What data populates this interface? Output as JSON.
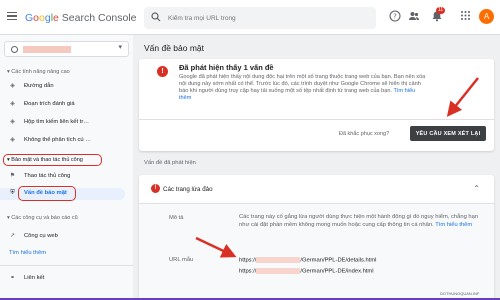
{
  "app": {
    "title_parts": [
      "G",
      "o",
      "o",
      "g",
      "l",
      "e",
      " Search Console"
    ]
  },
  "search": {
    "placeholder": "Kiểm tra mọi URL trong"
  },
  "topbar": {
    "notif_count": "11",
    "avatar_letter": "A"
  },
  "sidebar": {
    "section_enh": "Các tính năng nâng cao",
    "enh_items": [
      "Đường dẫn",
      "Đoạn trích đánh giá",
      "Hộp tìm kiếm liên kết tr…",
      "Không thể phân tích cú …"
    ],
    "section_sec": "Bảo mật và thao tác thủ công",
    "sec_items": [
      "Thao tác thủ công",
      "Vấn đề bảo mật"
    ],
    "section_legacy": "Các công cụ và báo cáo cũ",
    "legacy_items": [
      "Công cụ web"
    ],
    "learn_more": "Tìm hiểu thêm",
    "links_item": "Liên kết"
  },
  "main": {
    "page_title": "Vấn đề bảo mật",
    "alert": {
      "title": "Đã phát hiện thấy 1 vấn đề",
      "body": "Google đã phát hiện thấy nội dung độc hại trên một số trang thuộc trang web của bạn. Bạn nên xóa nội dung này sớm nhất có thể. Trước lúc đó, các trình duyệt như Google Chrome sẽ hiển thị cảnh báo khi người dùng truy cập hay tải xuống một số tệp nhất định từ trang web của bạn.",
      "learn_more": "Tìm hiểu thêm",
      "question": "Đã khắc phục xong?",
      "button": "YÊU CẦU XEM XÉT LẠI"
    },
    "detected_label": "Vấn đề đã phát hiện",
    "issue": {
      "title": "Các trang lừa đảo",
      "desc_label": "Mô tả",
      "desc": "Các trang này cố gắng lừa người dùng thực hiện một hành động gì đó nguy hiểm, chẳng hạn như cài đặt phần mềm không mong muốn hoặc cung cấp thông tin cá nhân.",
      "desc_link": "Tìm hiểu thêm",
      "url_label": "URL mẫu",
      "urls": [
        {
          "prefix": "https://",
          "suffix": "/German/PPL-DE/details.html"
        },
        {
          "prefix": "https://",
          "suffix": "/German/PPL-DE/index.html"
        }
      ]
    }
  },
  "watermark": "DOTHUNGQUAN.INF",
  "colors": {
    "accent": "#1a73e8",
    "error": "#d93025",
    "button": "#3c4043"
  }
}
